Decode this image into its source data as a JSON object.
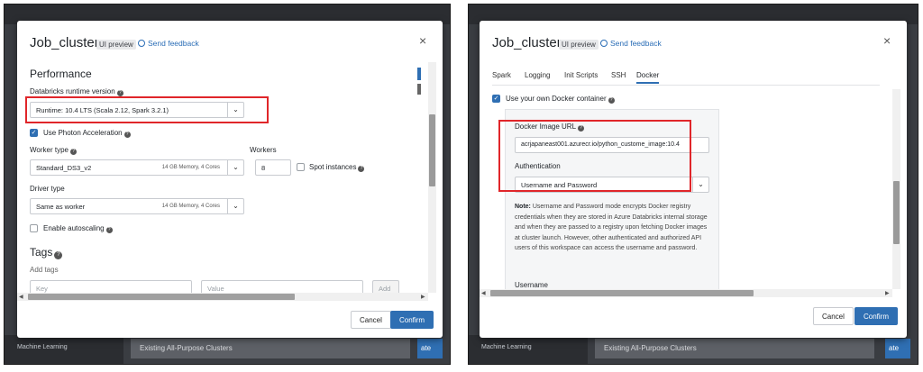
{
  "left": {
    "modal": {
      "title": "Job_cluster",
      "badge": "UI preview",
      "feedback": "Send feedback",
      "close": "×"
    },
    "performance": {
      "heading": "Performance",
      "runtime_label": "Databricks runtime version",
      "runtime_value": "Runtime: 10.4 LTS (Scala 2.12, Spark 3.2.1)",
      "photon_label": "Use Photon Acceleration",
      "worker_type_label": "Worker type",
      "worker_type_value": "Standard_DS3_v2",
      "worker_type_hint": "14 GB Memory, 4 Cores",
      "workers_label": "Workers",
      "workers_value": "8",
      "spot_label": "Spot instances",
      "driver_type_label": "Driver type",
      "driver_type_value": "Same as worker",
      "driver_type_hint": "14 GB Memory, 4 Cores",
      "autoscaling_label": "Enable autoscaling"
    },
    "tags": {
      "heading": "Tags",
      "add_tags_label": "Add tags",
      "key_placeholder": "Key",
      "value_placeholder": "Value",
      "add_button": "Add"
    },
    "footer": {
      "cancel": "Cancel",
      "confirm": "Confirm"
    },
    "background": {
      "nav_item": "Machine Learning",
      "bar_text": "Existing All-Purpose Clusters",
      "blue_btn": "ate"
    }
  },
  "right": {
    "modal": {
      "title": "Job_cluster",
      "badge": "UI preview",
      "feedback": "Send feedback",
      "close": "×"
    },
    "tabs": [
      "Spark",
      "Logging",
      "Init Scripts",
      "SSH",
      "Docker"
    ],
    "active_tab": "Docker",
    "docker": {
      "use_own_label": "Use your own Docker container",
      "image_url_label": "Docker Image URL",
      "image_url_value": "acrjapaneast001.azurecr.io/python_custome_image:10.4",
      "auth_label": "Authentication",
      "auth_value": "Username and Password",
      "note_bold": "Note:",
      "note_text": "Username and Password mode encrypts Docker registry credentials when they are stored in Azure Databricks internal storage and when they are passed to a registry upon fetching Docker images at cluster launch. However, other authenticated and authorized API users of this workspace can access the username and password.",
      "username_label": "Username"
    },
    "footer": {
      "cancel": "Cancel",
      "confirm": "Confirm"
    },
    "background": {
      "nav_item": "Machine Learning",
      "bar_text": "Existing All-Purpose Clusters",
      "blue_btn": "ate"
    }
  },
  "colors": {
    "accent": "#2f6fb3",
    "highlight": "#e0262a"
  }
}
